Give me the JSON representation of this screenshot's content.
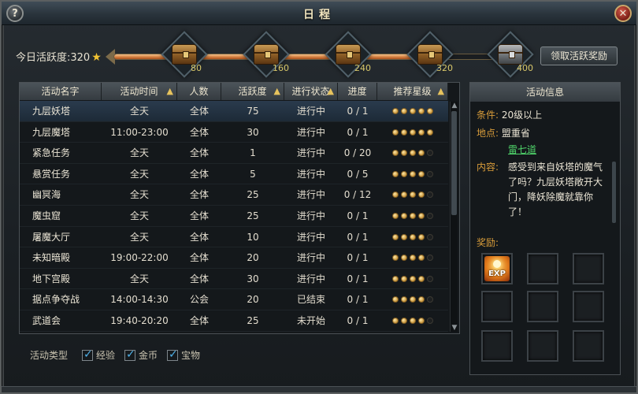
{
  "window": {
    "title": "日程"
  },
  "activity": {
    "label": "今日活跃度:320",
    "claim_button": "领取活跃奖励",
    "progress": 0.8,
    "milestones": [
      {
        "value": "80",
        "state": "open"
      },
      {
        "value": "160",
        "state": "open"
      },
      {
        "value": "240",
        "state": "open"
      },
      {
        "value": "320",
        "state": "open"
      },
      {
        "value": "400",
        "state": "locked"
      }
    ]
  },
  "table": {
    "headers": [
      "活动名字",
      "活动时间",
      "人数",
      "活跃度",
      "进行状态",
      "进度",
      "推荐星级"
    ],
    "rows": [
      {
        "name": "九层妖塔",
        "time": "全天",
        "people": "全体",
        "activity": "75",
        "status": "进行中",
        "progress": "0 / 1",
        "stars": 5
      },
      {
        "name": "九层魔塔",
        "time": "11:00-23:00",
        "people": "全体",
        "activity": "30",
        "status": "进行中",
        "progress": "0 / 1",
        "stars": 5
      },
      {
        "name": "紧急任务",
        "time": "全天",
        "people": "全体",
        "activity": "1",
        "status": "进行中",
        "progress": "0 / 20",
        "stars": 4
      },
      {
        "name": "悬赏任务",
        "time": "全天",
        "people": "全体",
        "activity": "5",
        "status": "进行中",
        "progress": "0 / 5",
        "stars": 4
      },
      {
        "name": "幽冥海",
        "time": "全天",
        "people": "全体",
        "activity": "25",
        "status": "进行中",
        "progress": "0 / 12",
        "stars": 4
      },
      {
        "name": "魔虫窟",
        "time": "全天",
        "people": "全体",
        "activity": "25",
        "status": "进行中",
        "progress": "0 / 1",
        "stars": 4
      },
      {
        "name": "屠魔大厅",
        "time": "全天",
        "people": "全体",
        "activity": "10",
        "status": "进行中",
        "progress": "0 / 1",
        "stars": 4
      },
      {
        "name": "未知暗殿",
        "time": "19:00-22:00",
        "people": "全体",
        "activity": "20",
        "status": "进行中",
        "progress": "0 / 1",
        "stars": 4
      },
      {
        "name": "地下宫殿",
        "time": "全天",
        "people": "全体",
        "activity": "30",
        "status": "进行中",
        "progress": "0 / 1",
        "stars": 4
      },
      {
        "name": "据点争夺战",
        "time": "14:00-14:30",
        "people": "公会",
        "activity": "20",
        "status": "已结束",
        "progress": "0 / 1",
        "stars": 4
      },
      {
        "name": "武道会",
        "time": "19:40-20:20",
        "people": "全体",
        "activity": "25",
        "status": "未开始",
        "progress": "0 / 1",
        "stars": 4
      }
    ]
  },
  "filter": {
    "label": "活动类型",
    "options": [
      "经验",
      "金币",
      "宝物"
    ]
  },
  "info": {
    "title": "活动信息",
    "condition_key": "条件:",
    "condition_value": "20级以上",
    "location_key": "地点:",
    "location_value": "盟重省",
    "location_link": "雷七道",
    "content_key": "内容:",
    "content_value": "感受到来自妖塔的魔气了吗？九层妖塔敞开大门，降妖除魔就靠你了！",
    "reward_label": "奖励:",
    "reward_item": "EXP"
  },
  "colors": {
    "accent_gold": "#d89c3a",
    "link_green": "#4fd36a",
    "check_blue": "#4fb0e8",
    "star_gold": "#f1c232"
  }
}
